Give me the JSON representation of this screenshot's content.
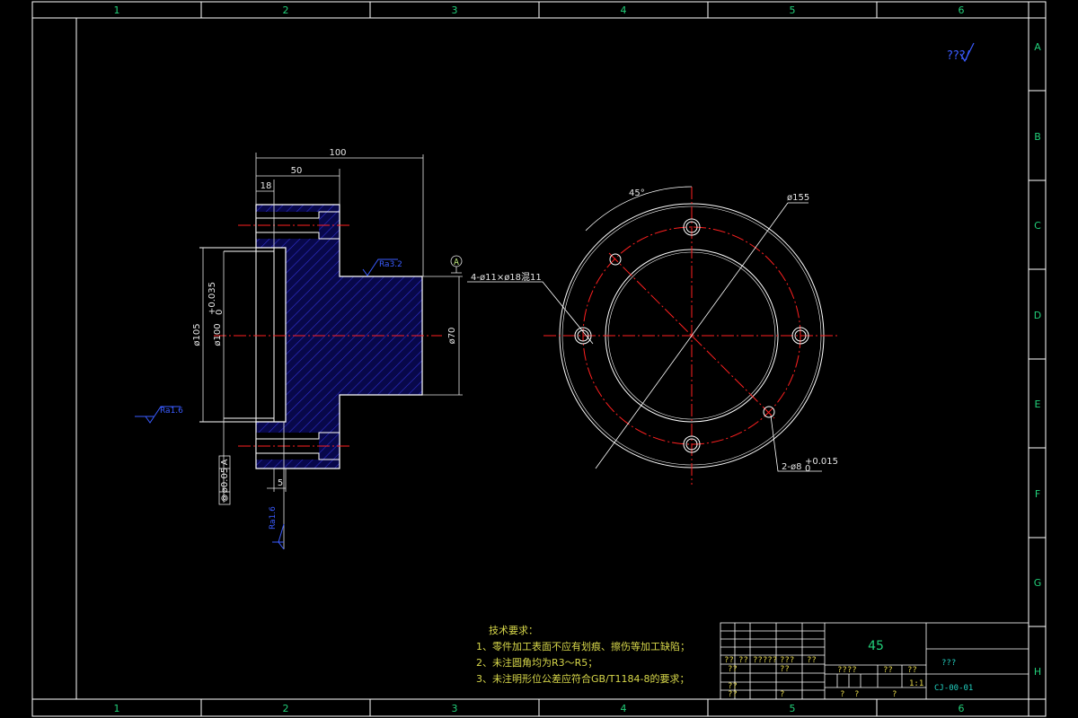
{
  "border": {
    "columns": [
      "1",
      "2",
      "3",
      "4",
      "5",
      "6"
    ],
    "rows": [
      "A",
      "B",
      "C",
      "D",
      "E",
      "F",
      "G",
      "H"
    ]
  },
  "roughness_mark": "???/",
  "dims": {
    "d100": "100",
    "d50": "50",
    "d18": "18",
    "d5": "5",
    "d105": "ø105",
    "d100tol": "ø100",
    "d100tol_sup": "+0.035",
    "d100tol_sub": "0",
    "d70": "ø70",
    "r_top": "Ra3.2",
    "r_left": "Ra1.6",
    "r_bottom": "Ra1.6",
    "datum": "A",
    "gdt_tol": "ø0.05",
    "gdt_ref": "A",
    "holes4": "4-ø11×ø18混11",
    "angle45": "45°",
    "d155": "ø155",
    "holes2": "2-ø8",
    "holes2_sup": "+0.015",
    "holes2_sub": "0"
  },
  "notes": {
    "title": "技术要求：",
    "items": [
      "1、零件加工表面不应有划痕、擦伤等加工缺陷；",
      "2、未注圆角均为R3～R5；",
      "3、未注明形位公差应符合GB/T1184-8的要求；"
    ]
  },
  "title_block": {
    "material": "45",
    "company": "???",
    "drawing_no": "CJ-00-01",
    "c1": "??",
    "c2": "??",
    "c3": "?????",
    "c4": "???",
    "c5": "??",
    "c6": "??",
    "c7": "??",
    "c8": "??",
    "c9": "????",
    "c10": "??",
    "c11": "??",
    "c12": "??",
    "c13": "?",
    "c14": "?",
    "c15": "?",
    "c16": "?",
    "scale": "1:1"
  },
  "colors": {
    "sheet": "#000000",
    "frame": "#ffffff",
    "centerline": "#ff2020",
    "hatch": "#3030d0",
    "dimension": "#e6e6e6",
    "roughness": "#3a5bff",
    "notes": "#d8d84a",
    "titleblock_text": "#22d07a"
  }
}
